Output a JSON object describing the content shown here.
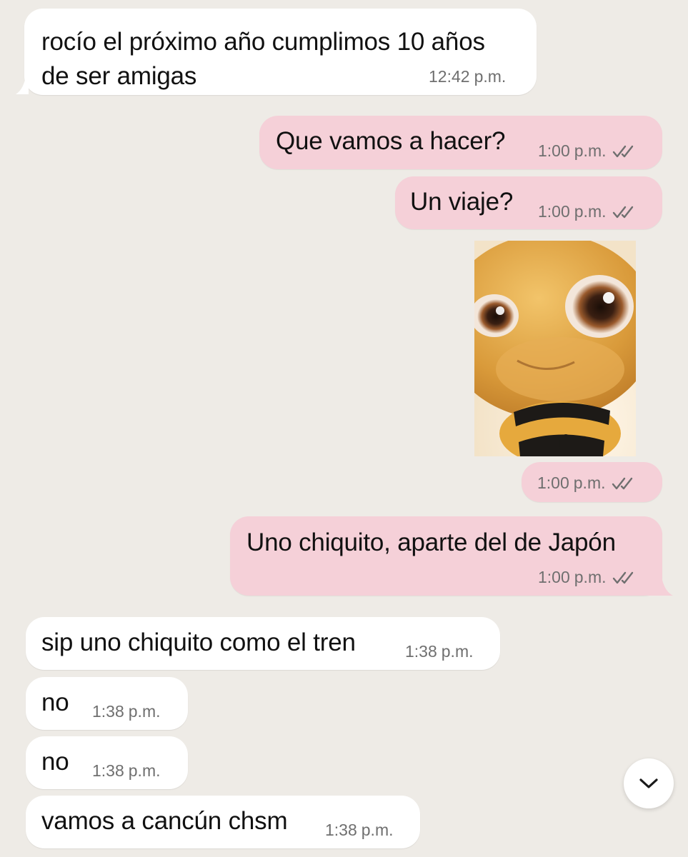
{
  "messages": [
    {
      "line1": "rocío el próximo año cumplimos 10 años",
      "line2": "de ser amigas",
      "time": "12:42",
      "ampm": "p.m."
    },
    {
      "text": "Que vamos a hacer?",
      "time": "1:00",
      "ampm": "p.m."
    },
    {
      "text": "Un viaje?",
      "time": "1:00",
      "ampm": "p.m."
    },
    {
      "time": "1:00",
      "ampm": "p.m."
    },
    {
      "text": "Uno chiquito, aparte del de Japón",
      "time": "1:00",
      "ampm": "p.m."
    },
    {
      "text": "sip uno chiquito como el tren",
      "time": "1:38",
      "ampm": "p.m."
    },
    {
      "text": "no",
      "time": "1:38",
      "ampm": "p.m."
    },
    {
      "text": "no",
      "time": "1:38",
      "ampm": "p.m."
    },
    {
      "text": "vamos a cancún chsm",
      "time": "1:38",
      "ampm": "p.m."
    }
  ],
  "icons": {
    "read_receipt": "double-check-icon",
    "sticker": "bee-sticker",
    "scroll_down": "chevron-down-icon"
  },
  "colors": {
    "background": "#eeebe6",
    "incoming_bubble": "#ffffff",
    "outgoing_bubble": "#f5d0d8"
  }
}
